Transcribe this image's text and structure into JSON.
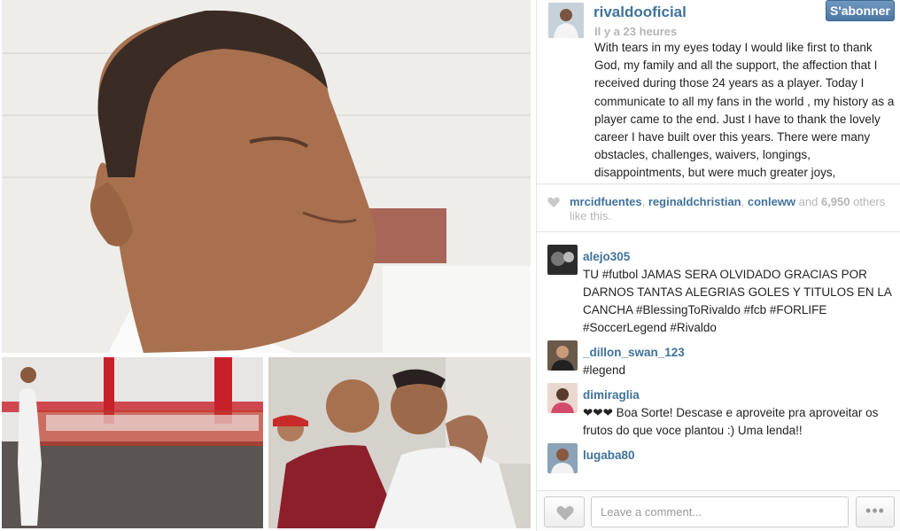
{
  "post": {
    "username": "rivaldooficial",
    "time_ago": "Il y a 23 heures",
    "follow_label": "S'abonner",
    "caption": "With tears in my eyes today I would like first to thank God, my family and all the support, the affection that I received during those 24 years as a player. Today I communicate to all my fans in the world , my history as a player came to the end. Just I have to thank the lovely career I have built over this years. There were many obstacles, challenges, waivers, longings, disappointments, but were much greater joys,"
  },
  "likes": {
    "user1": "mrcidfuentes",
    "sep1": ", ",
    "user2": "reginaldchristian",
    "sep2": ", ",
    "user3": "conleww",
    "and": " and ",
    "count": "6,950",
    "suffix": " others like this."
  },
  "comments": [
    {
      "user": "alejo305",
      "text": "TU #futbol JAMAS SERA OLVIDADO GRACIAS POR DARNOS TANTAS ALEGRIAS GOLES Y TITULOS EN LA CANCHA #BlessingToRivaldo #fcb #FORLIFE #SoccerLegend #Rivaldo"
    },
    {
      "user": "_dillon_swan_123",
      "text": "#legend"
    },
    {
      "user": "dimiraglia",
      "text": "❤❤❤ Boa Sorte! Descase e aproveite pra aproveitar os frutos do que voce plantou :) Uma lenda!!"
    },
    {
      "user": "lugaba80",
      "text": ""
    }
  ],
  "footer": {
    "comment_placeholder": "Leave a comment...",
    "more_label": "•••"
  }
}
